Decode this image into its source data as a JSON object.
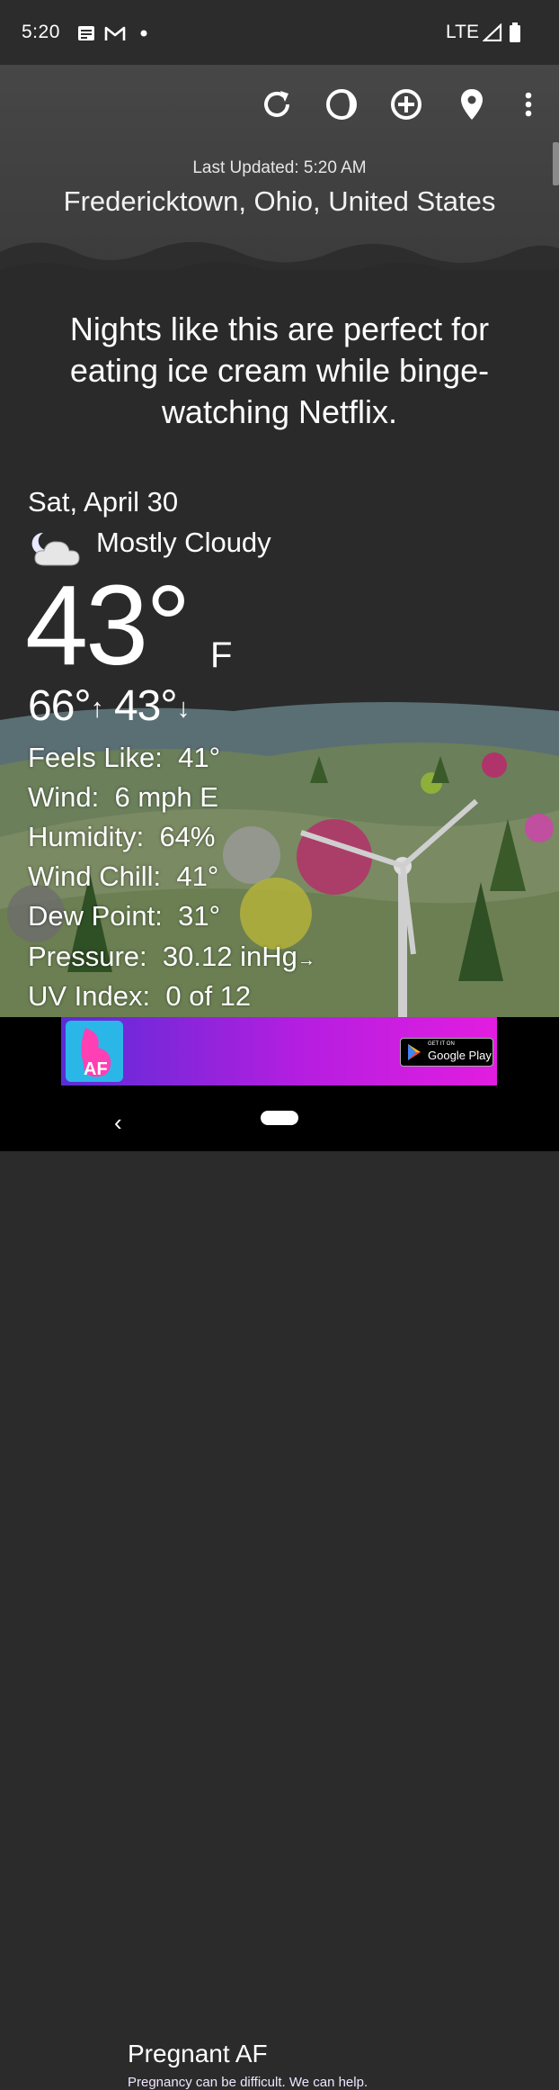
{
  "status_bar": {
    "time": "5:20",
    "network": "LTE"
  },
  "toolbar": {
    "icons": [
      "refresh-icon",
      "moon-phase-icon",
      "add-icon",
      "location-pin-icon",
      "more-vert-icon"
    ]
  },
  "header": {
    "last_updated": "Last Updated: 5:20 AM",
    "location": "Fredericktown, Ohio, United States"
  },
  "quote": "Nights like this are perfect for eating ice cream while binge-watching Netflix.",
  "current": {
    "date": "Sat, April 30",
    "condition": "Mostly Cloudy",
    "condition_icon": "partly-cloudy-night-icon",
    "temperature": "43°",
    "unit": "F",
    "high": "66°",
    "low": "43°"
  },
  "details": [
    {
      "label": "Feels Like:",
      "value": "41°"
    },
    {
      "label": "Wind:",
      "value": "6 mph E"
    },
    {
      "label": "Humidity:",
      "value": "64%"
    },
    {
      "label": "Wind Chill:",
      "value": "41°"
    },
    {
      "label": "Dew Point:",
      "value": "31°"
    },
    {
      "label": "Pressure:",
      "value": "30.12 inHg"
    },
    {
      "label": "UV Index:",
      "value": "0 of 12"
    }
  ],
  "ad": {
    "logo_text": "AF",
    "title": "Pregnant AF",
    "subtitle": "Pregnancy can be difficult. We can help.",
    "store_small": "GET IT ON",
    "store_big": "Google Play"
  },
  "colors": {
    "ad_start": "#5a2dd6",
    "ad_end": "#e21de0",
    "background": "#2a2a2a"
  }
}
